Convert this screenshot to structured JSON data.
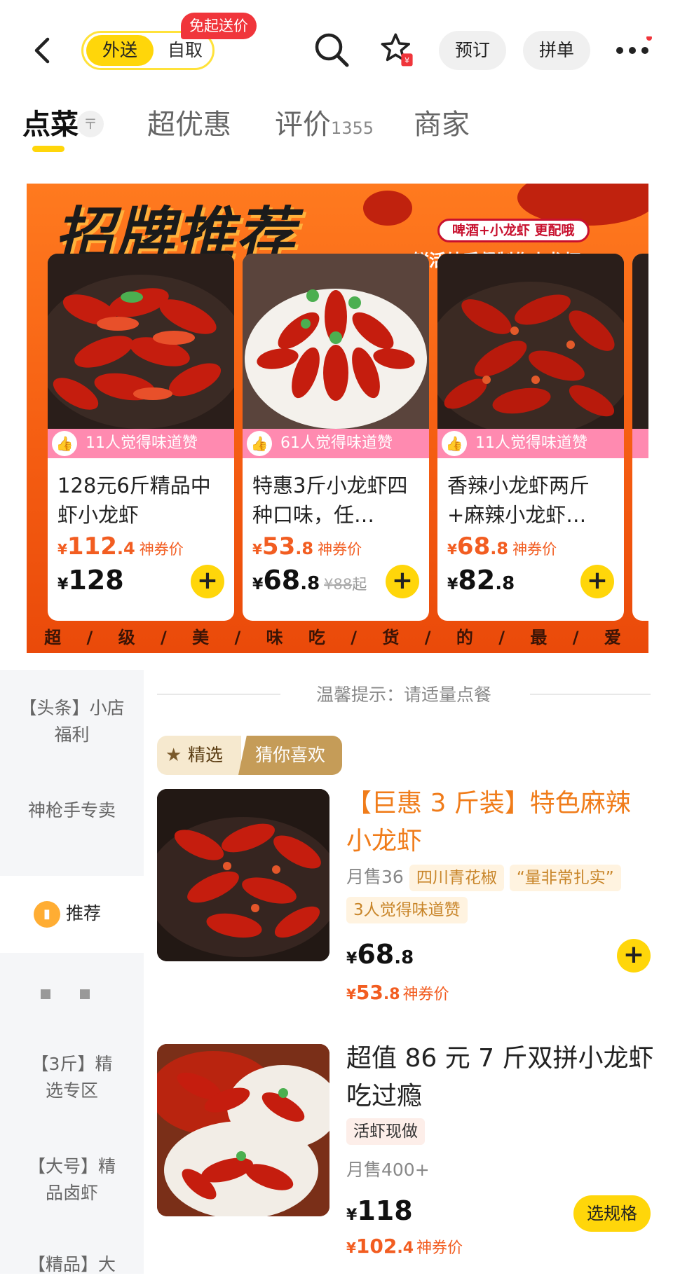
{
  "topbar": {
    "delivery_label": "外送",
    "pickup_label": "自取",
    "free_badge": "免起送价",
    "reserve_label": "预订",
    "group_label": "拼单"
  },
  "tabs": [
    {
      "label": "点菜"
    },
    {
      "label": "超优惠"
    },
    {
      "label": "评价",
      "count": "1355"
    },
    {
      "label": "商家"
    }
  ],
  "banner": {
    "title": "招牌推荐",
    "pill": "啤酒+小龙虾 更配哦",
    "side_text": "鲜活纯手餐制作小龙虾",
    "footer": "超 / 级 / 美 / 味   吃 / 货 / 的 / 最 / 爱",
    "cards": [
      {
        "likes": "11人觉得味道赞",
        "name": "128元6斤精品中虾小龙虾",
        "cp_int": "112",
        "cp_dec": ".4",
        "cp_label": "神券价",
        "price_int": "128",
        "price_dec": "",
        "orig": "",
        "orig_suffix": ""
      },
      {
        "likes": "61人觉得味道赞",
        "name": "特惠3斤小龙虾四种口味，任…",
        "cp_int": "53",
        "cp_dec": ".8",
        "cp_label": "神券价",
        "price_int": "68",
        "price_dec": ".8",
        "orig": "¥88",
        "orig_suffix": "起"
      },
      {
        "likes": "11人觉得味道赞",
        "name": "香辣小龙虾两斤+麻辣小龙虾…",
        "cp_int": "68",
        "cp_dec": ".8",
        "cp_label": "神券价",
        "price_int": "82",
        "price_dec": ".8",
        "orig": "",
        "orig_suffix": ""
      }
    ]
  },
  "sidebar": {
    "items": [
      "【头条】小店福利",
      "神枪手专卖",
      "推荐",
      "【3斤】精选专区",
      "【大号】精品卤虾",
      "【精品】大"
    ]
  },
  "main": {
    "tip": "温馨提示：请适量点餐",
    "select_a": "精选",
    "select_b": "猜你喜欢",
    "products": [
      {
        "name": "【巨惠 3 斤装】特色麻辣小龙虾",
        "sold": "月售36",
        "tags": [
          "四川青花椒",
          "“量非常扎实”"
        ],
        "likes": "3人觉得味道赞",
        "price_int": "68",
        "price_dec": ".8",
        "cp_int": "53",
        "cp_dec": ".8",
        "cp_label": "神券价"
      },
      {
        "name": "超值 86 元 7 斤双拼小龙虾吃过瘾",
        "tag": "活虾现做",
        "sold": "月售400+",
        "price_int": "118",
        "price_dec": "",
        "cp_int": "102",
        "cp_dec": ".4",
        "cp_label": "神券价",
        "spec_label": "选规格"
      }
    ]
  }
}
